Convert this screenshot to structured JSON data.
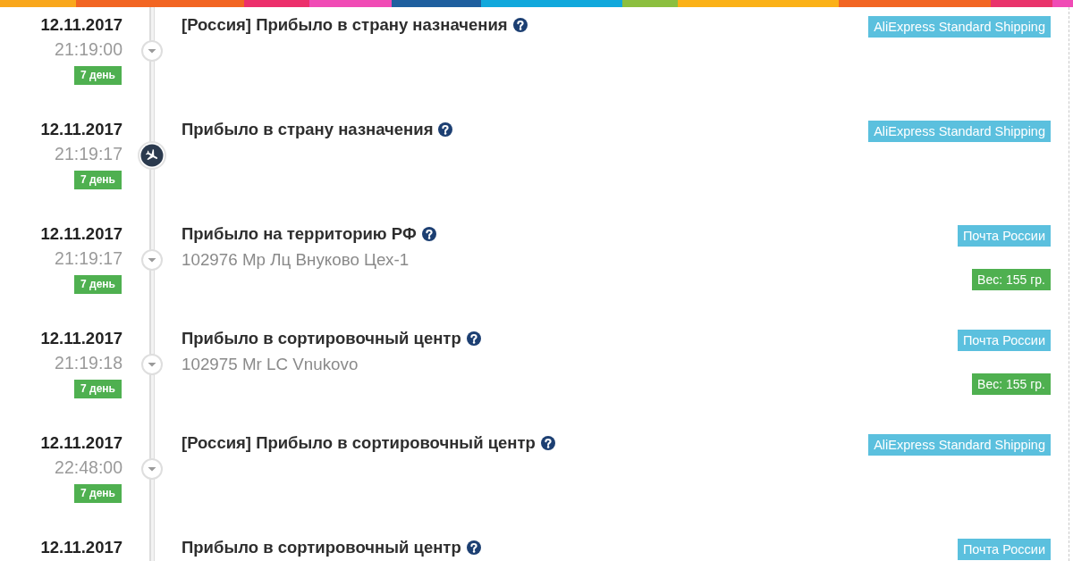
{
  "events": [
    {
      "kind": "caret",
      "date": "12.11.2017",
      "time": "21:19:00",
      "day_badge": "7 день",
      "title": "[Россия] Прибыло в страну назначения",
      "carrier": "AliExpress Standard Shipping"
    },
    {
      "kind": "landing",
      "date": "12.11.2017",
      "time": "21:19:17",
      "day_badge": "7 день",
      "title": "Прибыло в страну назначения",
      "carrier": "AliExpress Standard Shipping"
    },
    {
      "kind": "caret",
      "date": "12.11.2017",
      "time": "21:19:17",
      "day_badge": "7 день",
      "title": "Прибыло на территорию РФ",
      "location": "102976 Мр Лц Внуково Цех-1",
      "carrier": "Почта России",
      "weight": "Вес: 155 гр."
    },
    {
      "kind": "caret",
      "date": "12.11.2017",
      "time": "21:19:18",
      "day_badge": "7 день",
      "title": "Прибыло в сортировочный центр",
      "location": "102975 Mr LC Vnukovo",
      "carrier": "Почта России",
      "weight": "Вес: 155 гр."
    },
    {
      "kind": "caret",
      "date": "12.11.2017",
      "time": "22:48:00",
      "day_badge": "7 день",
      "title": "[Россия] Прибыло в сортировочный центр",
      "carrier": "AliExpress Standard Shipping"
    },
    {
      "date": "12.11.2017",
      "title": "Прибыло в сортировочный центр",
      "carrier": "Почта России"
    }
  ]
}
